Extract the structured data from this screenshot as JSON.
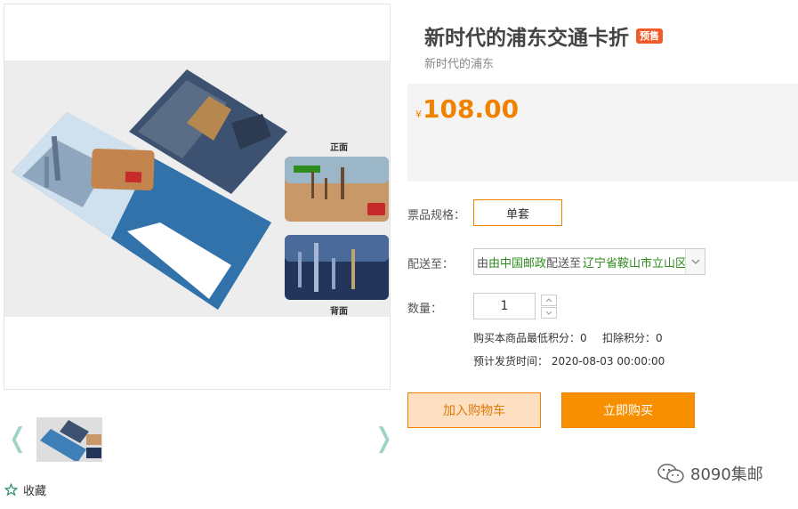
{
  "gallery": {
    "label_front": "正面",
    "label_back": "背面",
    "prev_arrow": "❬",
    "next_arrow": "❭"
  },
  "favorite": {
    "label": "收藏",
    "icon": "star-outline-icon"
  },
  "product": {
    "title": "新时代的浦东交通卡折",
    "badge": "预售",
    "subtitle": "新时代的浦东",
    "currency": "¥",
    "price": "108.00"
  },
  "spec": {
    "label": "票品规格：",
    "option": "单套"
  },
  "shipping": {
    "label": "配送至：",
    "carrier": "由中国邮政",
    "deliver_to": "配送至",
    "location": "辽宁省鞍山市立山区"
  },
  "quantity": {
    "label": "数量：",
    "value": "1"
  },
  "points": {
    "min_points": "购买本商品最低积分：0",
    "deduct_points": "扣除积分：0",
    "ship_date": "预计发货时间： 2020-08-03 00:00:00"
  },
  "actions": {
    "add_to_cart": "加入购物车",
    "buy_now": "立即购买"
  },
  "watermark": {
    "text": "8090集邮"
  },
  "colors": {
    "accent": "#f08200",
    "badge": "#f05a28",
    "green": "#2e8b1e"
  }
}
